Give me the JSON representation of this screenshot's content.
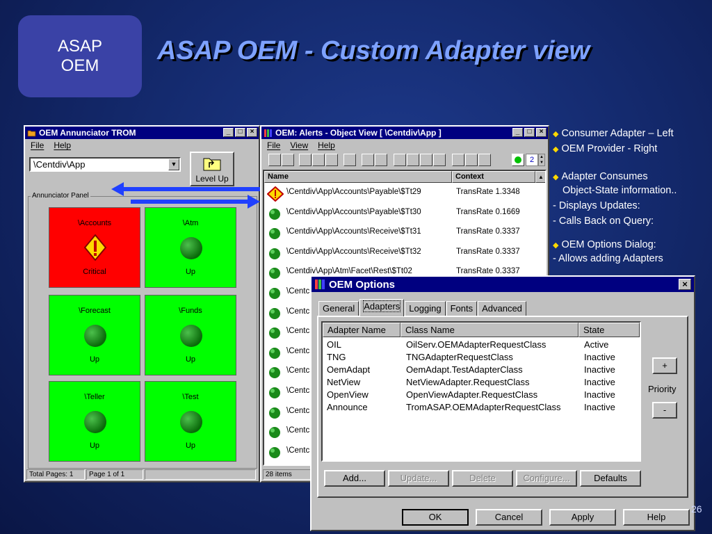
{
  "slide": {
    "logo_line1": "ASAP",
    "logo_line2": "OEM",
    "title": "ASAP OEM - Custom Adapter view",
    "page_number": "26"
  },
  "bullets": [
    {
      "text": "Consumer Adapter – Left",
      "marker": true
    },
    {
      "text": "OEM Provider - Right",
      "marker": true
    },
    {
      "text": "Adapter Consumes",
      "marker": true
    },
    {
      "text": "Object-State information..",
      "marker": false
    },
    {
      "text": "- Displays Updates:",
      "marker": false
    },
    {
      "text": "- Calls Back on Query:",
      "marker": false
    },
    {
      "text": "OEM Options Dialog:",
      "marker": true
    },
    {
      "text": "-  Allows adding Adapters",
      "marker": false
    }
  ],
  "annunciator": {
    "title": "OEM Annunciator TROM",
    "menu": [
      "File",
      "Help"
    ],
    "combo_value": "\\Centdiv\\App",
    "level_up_label": "Level Up",
    "panel_label": "Annunciator Panel",
    "tiles": [
      {
        "name": "\\Accounts",
        "status": "Critical",
        "color": "#ff0000",
        "state": "critical"
      },
      {
        "name": "\\Atm",
        "status": "Up",
        "color": "#00ff00",
        "state": "up"
      },
      {
        "name": "\\Forecast",
        "status": "Up",
        "color": "#00ff00",
        "state": "up"
      },
      {
        "name": "\\Funds",
        "status": "Up",
        "color": "#00ff00",
        "state": "up"
      },
      {
        "name": "\\Teller",
        "status": "Up",
        "color": "#00ff00",
        "state": "up"
      },
      {
        "name": "\\Test",
        "status": "Up",
        "color": "#00ff00",
        "state": "up"
      }
    ],
    "status_total": "Total Pages: 1",
    "status_page": "Page 1 of 1"
  },
  "object_view": {
    "title": "OEM: Alerts - Object View [ \\Centdiv\\App ]",
    "menu": [
      "File",
      "View",
      "Help"
    ],
    "spinner_value": "2",
    "col_name": "Name",
    "col_context": "Context",
    "rows": [
      {
        "name": "\\Centdiv\\App\\Accounts\\Payable\\$Tt29",
        "context": "TransRate 1.3348",
        "state": "critical"
      },
      {
        "name": "\\Centdiv\\App\\Accounts\\Payable\\$Tt30",
        "context": "TransRate 0.1669",
        "state": "up"
      },
      {
        "name": "\\Centdiv\\App\\Accounts\\Receive\\$Tt31",
        "context": "TransRate 0.3337",
        "state": "up"
      },
      {
        "name": "\\Centdiv\\App\\Accounts\\Receive\\$Tt32",
        "context": "TransRate 0.3337",
        "state": "up"
      },
      {
        "name": "\\Centdiv\\App\\Atm\\Facet\\Rest\\$Tt02",
        "context": "TransRate 0.3337",
        "state": "up"
      },
      {
        "name": "\\Centc",
        "context": "",
        "state": "up"
      },
      {
        "name": "\\Centc",
        "context": "",
        "state": "up"
      },
      {
        "name": "\\Centc",
        "context": "",
        "state": "up"
      },
      {
        "name": "\\Centc",
        "context": "",
        "state": "up"
      },
      {
        "name": "\\Centc",
        "context": "",
        "state": "up"
      },
      {
        "name": "\\Centc",
        "context": "",
        "state": "up"
      },
      {
        "name": "\\Centc",
        "context": "",
        "state": "up"
      },
      {
        "name": "\\Centc",
        "context": "",
        "state": "up"
      },
      {
        "name": "\\Centc",
        "context": "",
        "state": "up"
      },
      {
        "name": "\\Centc",
        "context": "",
        "state": "up"
      }
    ],
    "status_items": "28 items"
  },
  "options": {
    "title": "OEM Options",
    "tabs": [
      "General",
      "Adapters",
      "Logging",
      "Fonts",
      "Advanced"
    ],
    "active_tab": "Adapters",
    "columns": [
      "Adapter Name",
      "Class Name",
      "State"
    ],
    "adapters": [
      {
        "name": "OIL",
        "class": "OilServ.OEMAdapterRequestClass",
        "state": "Active"
      },
      {
        "name": "TNG",
        "class": "TNGAdapterRequestClass",
        "state": "Inactive"
      },
      {
        "name": "OemAdapt",
        "class": "OemAdapt.TestAdapterClass",
        "state": "Inactive"
      },
      {
        "name": "NetView",
        "class": "NetViewAdapter.RequestClass",
        "state": "Inactive"
      },
      {
        "name": "OpenView",
        "class": "OpenViewAdapter.RequestClass",
        "state": "Inactive"
      },
      {
        "name": "Announce",
        "class": "TromASAP.OEMAdapterRequestClass",
        "state": "Inactive"
      }
    ],
    "priority_label": "Priority",
    "plus": "+",
    "minus": "-",
    "buttons": {
      "add": "Add...",
      "update": "Update...",
      "delete": "Delete",
      "configure": "Configure...",
      "defaults": "Defaults"
    },
    "footer": {
      "ok": "OK",
      "cancel": "Cancel",
      "apply": "Apply",
      "help": "Help"
    }
  }
}
